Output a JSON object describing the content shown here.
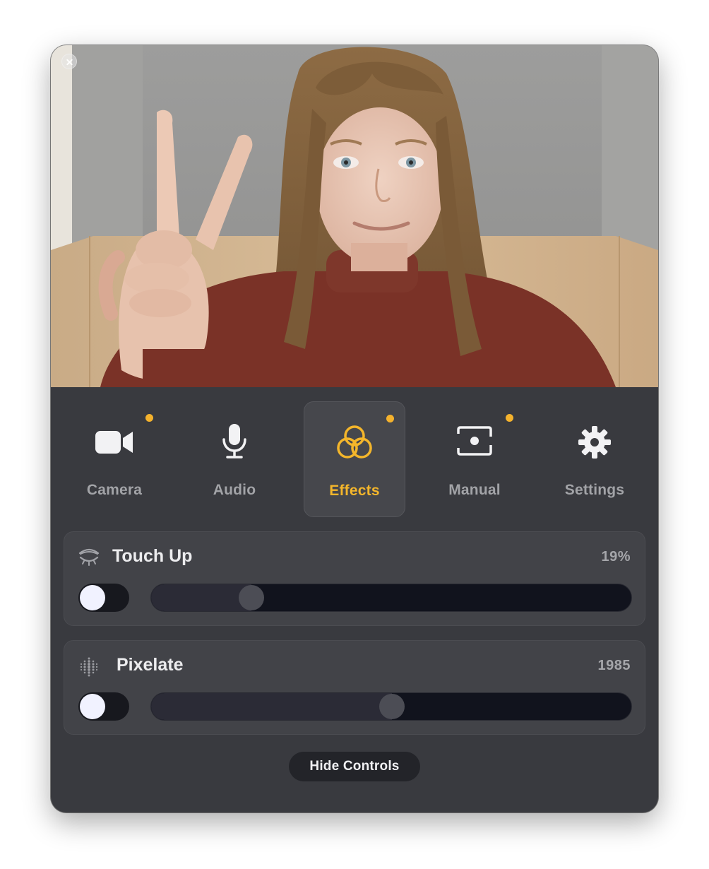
{
  "window": {
    "close_icon": "close-icon"
  },
  "preview": {
    "icon": "camera-feed-image"
  },
  "tabs": [
    {
      "label": "Camera",
      "icon": "video-camera-icon",
      "dot": true,
      "active": false
    },
    {
      "label": "Audio",
      "icon": "microphone-icon",
      "dot": false,
      "active": false
    },
    {
      "label": "Effects",
      "icon": "effects-circles-icon",
      "dot": true,
      "active": true
    },
    {
      "label": "Manual",
      "icon": "manual-focus-icon",
      "dot": true,
      "active": false
    },
    {
      "label": "Settings",
      "icon": "gear-icon",
      "dot": false,
      "active": false
    }
  ],
  "effects": {
    "touch_up": {
      "title": "Touch Up",
      "value": "19%",
      "icon": "closed-eye-icon",
      "enabled": false,
      "level": 0.19
    },
    "pixelate": {
      "title": "Pixelate",
      "value": "1985",
      "icon": "pixelate-dots-icon",
      "enabled": false,
      "level": 0.5
    }
  },
  "footer": {
    "hide_controls_label": "Hide Controls"
  },
  "colors": {
    "accent": "#f4b62b",
    "panel": "#393a3f",
    "card": "#424348",
    "track": "#11131d",
    "knob": "#f1f2ff"
  }
}
